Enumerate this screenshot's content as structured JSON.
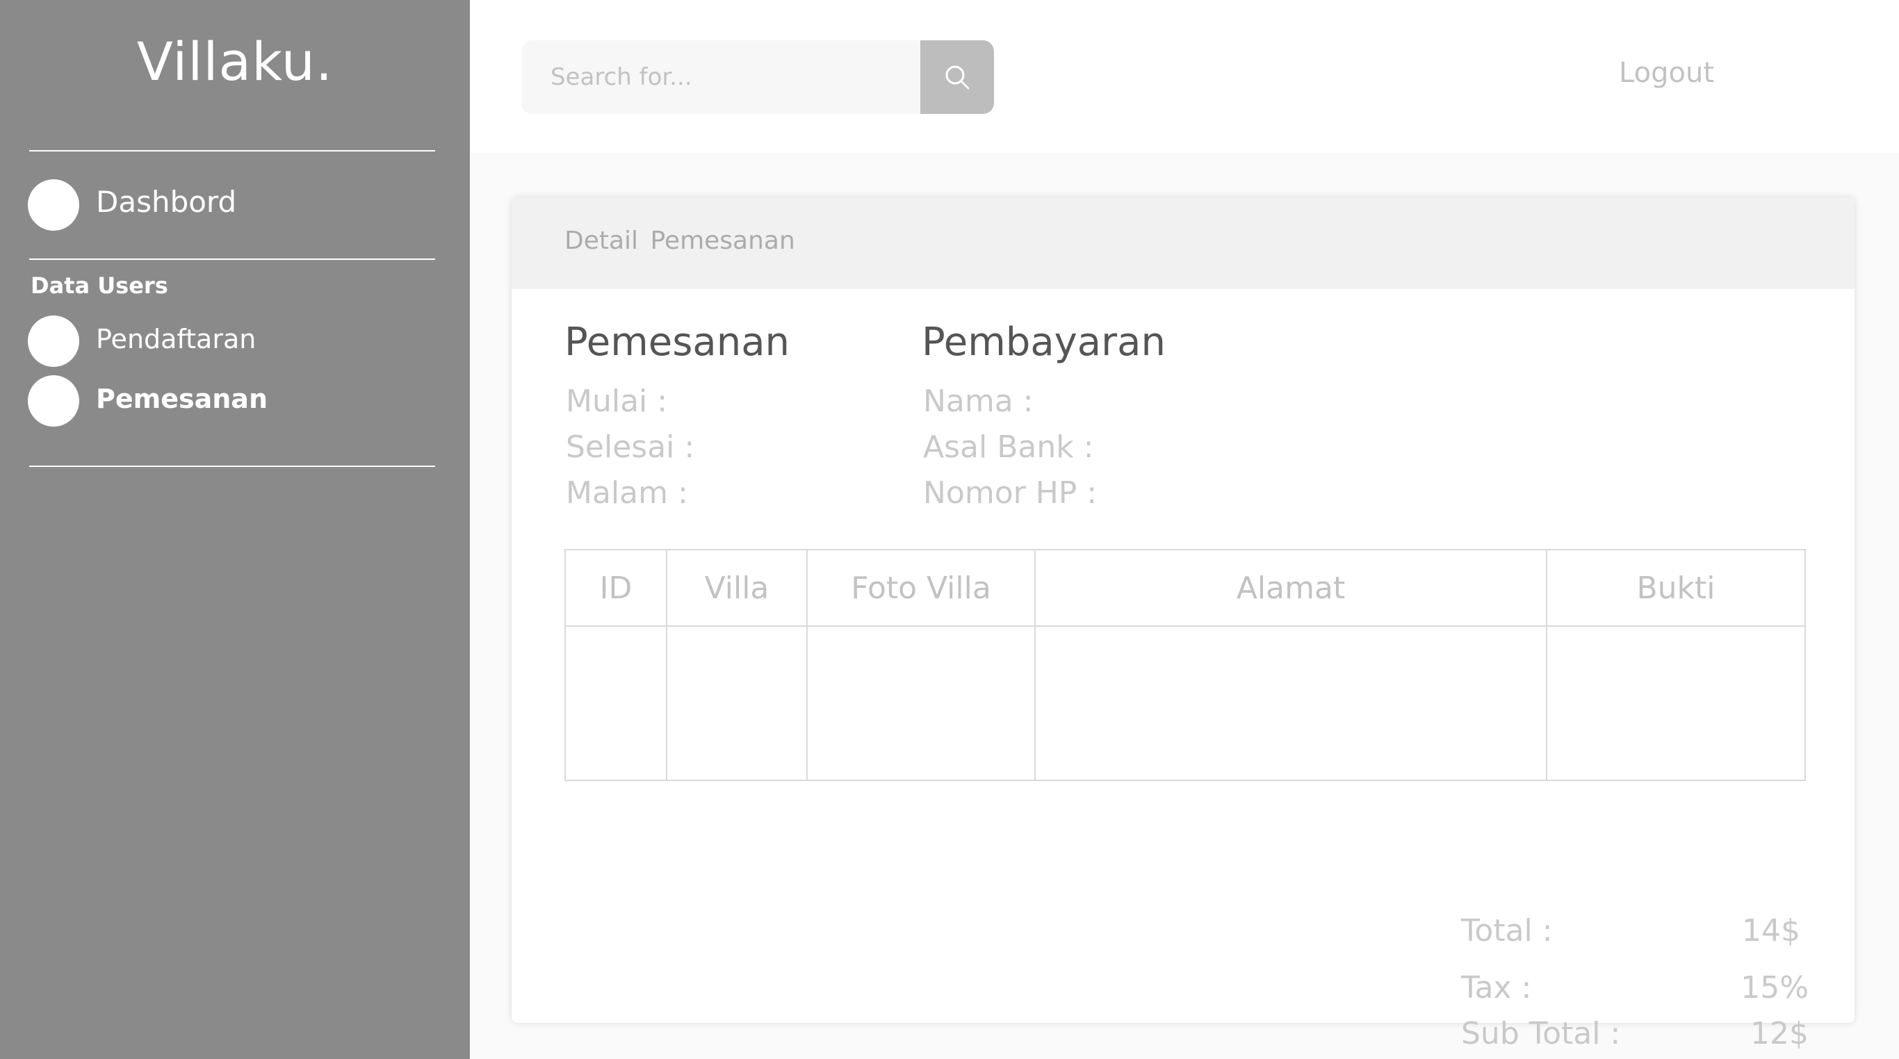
{
  "sidebar": {
    "brand": "Villaku.",
    "items": [
      {
        "label": "Dashbord"
      },
      {
        "label": "Pendaftaran"
      },
      {
        "label": "Pemesanan"
      }
    ],
    "section_label": "Data Users"
  },
  "header": {
    "search_placeholder": "Search for...",
    "logout_label": "Logout"
  },
  "card": {
    "title": "Detail  Pemesanan",
    "pemesanan": {
      "heading": "Pemesanan",
      "fields": [
        "Mulai :",
        "Selesai :",
        "Malam :"
      ]
    },
    "pembayaran": {
      "heading": "Pembayaran",
      "fields": [
        "Nama :",
        "Asal Bank :",
        "Nomor HP :"
      ]
    },
    "table": {
      "columns": [
        "ID",
        "Villa",
        "Foto Villa",
        "Alamat",
        "Bukti"
      ]
    },
    "totals": [
      {
        "label": "Tax :",
        "value": "15%"
      },
      {
        "label": "Sub Total :",
        "value": "12$"
      },
      {
        "label": "Total :",
        "value": "14$"
      }
    ]
  },
  "colors": {
    "sidebar_bg": "#8a8a8a",
    "search_button_bg": "#bdbdbd",
    "card_header_bg": "#f1f1f1",
    "muted_text": "#c2c2c2"
  }
}
